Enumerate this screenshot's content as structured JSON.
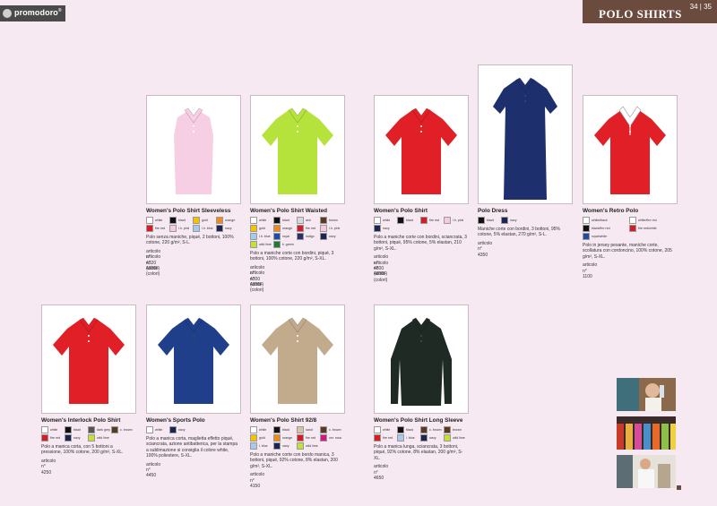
{
  "brand": {
    "logo_text": "promodoro",
    "logo_sup": "®"
  },
  "header": {
    "title": "POLO SHIRTS",
    "pages": "34 | 35"
  },
  "colors": {
    "band": "#6a4b3d",
    "bg": "#f6e9f1"
  },
  "products": [
    {
      "name": "Women's Polo Shirt Sleeveless",
      "shirt_color": "#f7cfe4",
      "swatches": [
        {
          "label": "white",
          "color": "#ffffff"
        },
        {
          "label": "black",
          "color": "#111111"
        },
        {
          "label": "gold",
          "color": "#f0c400"
        },
        {
          "label": "orange",
          "color": "#f08a1c"
        },
        {
          "label": "fire red",
          "color": "#d41e26"
        },
        {
          "label": "l.h. pink",
          "color": "#f6cadf"
        },
        {
          "label": "l.h. blue",
          "color": "#a8c8ec"
        },
        {
          "label": "navy",
          "color": "#1b2552"
        }
      ],
      "desc": "Polo senza maniche, piqué, 2 bottoni, 100% cotone, 220 g/m², S-L.",
      "art": [
        "articolo n° 4320 (white)",
        "articolo n° 4320F (colori)"
      ]
    },
    {
      "name": "Women's Polo Shirt Waisted",
      "shirt_color": "#b5e33b",
      "swatches": [
        {
          "label": "white",
          "color": "#ffffff"
        },
        {
          "label": "black",
          "color": "#111111"
        },
        {
          "label": "ash",
          "color": "#d9d9d9"
        },
        {
          "label": "brown",
          "color": "#5a3a22"
        },
        {
          "label": "gold",
          "color": "#f0c400"
        },
        {
          "label": "orange",
          "color": "#f08a1c"
        },
        {
          "label": "fire red",
          "color": "#d41e26"
        },
        {
          "label": "l.h. pink",
          "color": "#f6cadf"
        },
        {
          "label": "l.h. blue",
          "color": "#a8c8ec"
        },
        {
          "label": "royal",
          "color": "#1f4aa8"
        },
        {
          "label": "indigo",
          "color": "#2b2f66"
        },
        {
          "label": "navy",
          "color": "#1b2552"
        },
        {
          "label": "wild lime",
          "color": "#c4e03a"
        },
        {
          "label": "k. green",
          "color": "#1f7a35"
        }
      ],
      "desc": "Polo a maniche corte con bordini, piqué, 3 bottoni, 100% cotone, 220 g/m², S-XL.",
      "art": [
        "articolo n° 4300 (white)",
        "articolo n° 4300F (colori)"
      ]
    },
    {
      "name": "Women's Polo Shirt",
      "shirt_color": "#e01f26",
      "swatches": [
        {
          "label": "white",
          "color": "#ffffff"
        },
        {
          "label": "black",
          "color": "#111111"
        },
        {
          "label": "fire red",
          "color": "#d41e26"
        },
        {
          "label": "l.h. pink",
          "color": "#f6cadf"
        },
        {
          "label": "navy",
          "color": "#1b2552"
        }
      ],
      "desc": "Polo a maniche corte con bordini, sciancrata, 3 bottoni, piqué, 95% cotone, 5% elastan, 210 g/m², S-XL.",
      "art": [
        "articolo n° 4800 (white)",
        "articolo n° 4800F (colori)"
      ]
    },
    {
      "name": "Polo Dress",
      "shirt_color": "#1e2f6e",
      "swatches": [
        {
          "label": "black",
          "color": "#111111"
        },
        {
          "label": "navy",
          "color": "#1b2552"
        }
      ],
      "desc": "Maniche corte con bordini, 3 bottoni, 95% cotone, 5% elastan, 270 g/m², S-L.",
      "art": [
        "articolo n° 4350"
      ]
    },
    {
      "name": "Women's Retro Polo",
      "shirt_color": "#e01f26",
      "swatches2": [
        {
          "label": "white/black",
          "color": "#ffffff"
        },
        {
          "label": "white/fire red",
          "color": "#ffffff"
        },
        {
          "label": "black/fire red",
          "color": "#111111"
        },
        {
          "label": "fire red/white",
          "color": "#d41e26"
        },
        {
          "label": "royal/white",
          "color": "#1f4aa8"
        }
      ],
      "desc": "Polo in jersey pesante, maniche corte, scollatura con cordoncino, 100% cotone, 205 g/m², S-XL.",
      "art": [
        "articolo n° 1100"
      ]
    },
    {
      "name": "Women's Interlock Polo Shirt",
      "shirt_color": "#e01f26",
      "swatches": [
        {
          "label": "white",
          "color": "#ffffff"
        },
        {
          "label": "black",
          "color": "#111111"
        },
        {
          "label": "dark grey",
          "color": "#555555"
        },
        {
          "label": "c. brown",
          "color": "#5a3a22"
        },
        {
          "label": "fire red",
          "color": "#d41e26"
        },
        {
          "label": "navy",
          "color": "#1b2552"
        },
        {
          "label": "wild lime",
          "color": "#c4e03a"
        }
      ],
      "desc": "Polo a manica corta, con 5 bottoni a pressione, 100% cotone, 200 g/m², S-XL.",
      "art": [
        "articolo n° 4250"
      ]
    },
    {
      "name": "Women's Sports Polo",
      "shirt_color": "#1f3f8a",
      "swatches": [
        {
          "label": "white",
          "color": "#ffffff"
        },
        {
          "label": "navy",
          "color": "#1b2552"
        }
      ],
      "desc": "Polo a manica corta, maglietta effetto piqué, sciancrata, azione antibatterica, per la stampa a sublimazione si consiglia il colore white, 100% poliestere, S-XL.",
      "art": [
        "articolo n° 4450"
      ]
    },
    {
      "name": "Women's Polo Shirt 92/8",
      "shirt_color": "#c2aa8c",
      "swatches": [
        {
          "label": "white",
          "color": "#ffffff"
        },
        {
          "label": "black",
          "color": "#111111"
        },
        {
          "label": "sand",
          "color": "#d8c3a5"
        },
        {
          "label": "c. brown",
          "color": "#5a3a22"
        },
        {
          "label": "gold",
          "color": "#f0c400"
        },
        {
          "label": "orange",
          "color": "#f08a1c"
        },
        {
          "label": "fire red",
          "color": "#d41e26"
        },
        {
          "label": "cer. rosa",
          "color": "#d4177a"
        },
        {
          "label": "l. blue",
          "color": "#a8c8ec"
        },
        {
          "label": "navy",
          "color": "#1b2552"
        },
        {
          "label": "wild lime",
          "color": "#c4e03a"
        }
      ],
      "desc": "Polo a maniche corte con bordo manica, 3 bottoni, piqué, 92% cotone, 8% elastan, 200 g/m², S-XL.",
      "art": [
        "articolo n° 4150"
      ]
    },
    {
      "name": "Women's Polo Shirt Long Sleeve",
      "shirt_color": "#1f2a24",
      "swatches": [
        {
          "label": "white",
          "color": "#ffffff"
        },
        {
          "label": "black",
          "color": "#111111"
        },
        {
          "label": "c. brown",
          "color": "#5a3a22"
        },
        {
          "label": "brown",
          "color": "#5a3a22"
        },
        {
          "label": "fire red",
          "color": "#d41e26"
        },
        {
          "label": "l. blue",
          "color": "#a8c8ec"
        },
        {
          "label": "navy",
          "color": "#1b2552"
        },
        {
          "label": "wild lime",
          "color": "#c4e03a"
        }
      ],
      "desc": "Polo a manica lunga, sciancrata, 3 bottoni, piqué, 92% cotone, 8% elastan, 200 g/m², S-XL.",
      "art": [
        "articolo n° 4650"
      ]
    }
  ]
}
